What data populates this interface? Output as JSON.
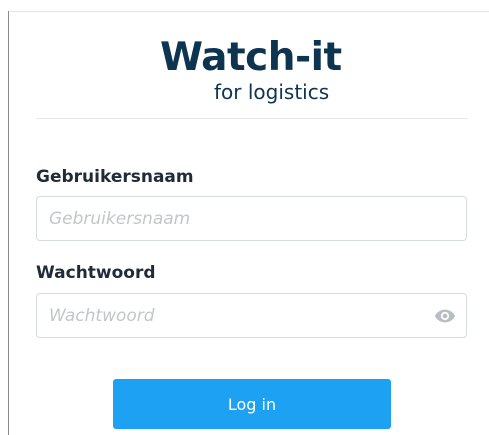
{
  "brand": {
    "name": "Watch-it",
    "tagline": "for logistics"
  },
  "form": {
    "username": {
      "label": "Gebruikersnaam",
      "placeholder": "Gebruikersnaam",
      "value": ""
    },
    "password": {
      "label": "Wachtwoord",
      "placeholder": "Wachtwoord",
      "value": "",
      "toggle_icon": "eye-icon"
    },
    "submit_label": "Log in"
  },
  "colors": {
    "brand": "#0e3550",
    "accent": "#1da1f2",
    "placeholder": "#c2c6cb"
  }
}
